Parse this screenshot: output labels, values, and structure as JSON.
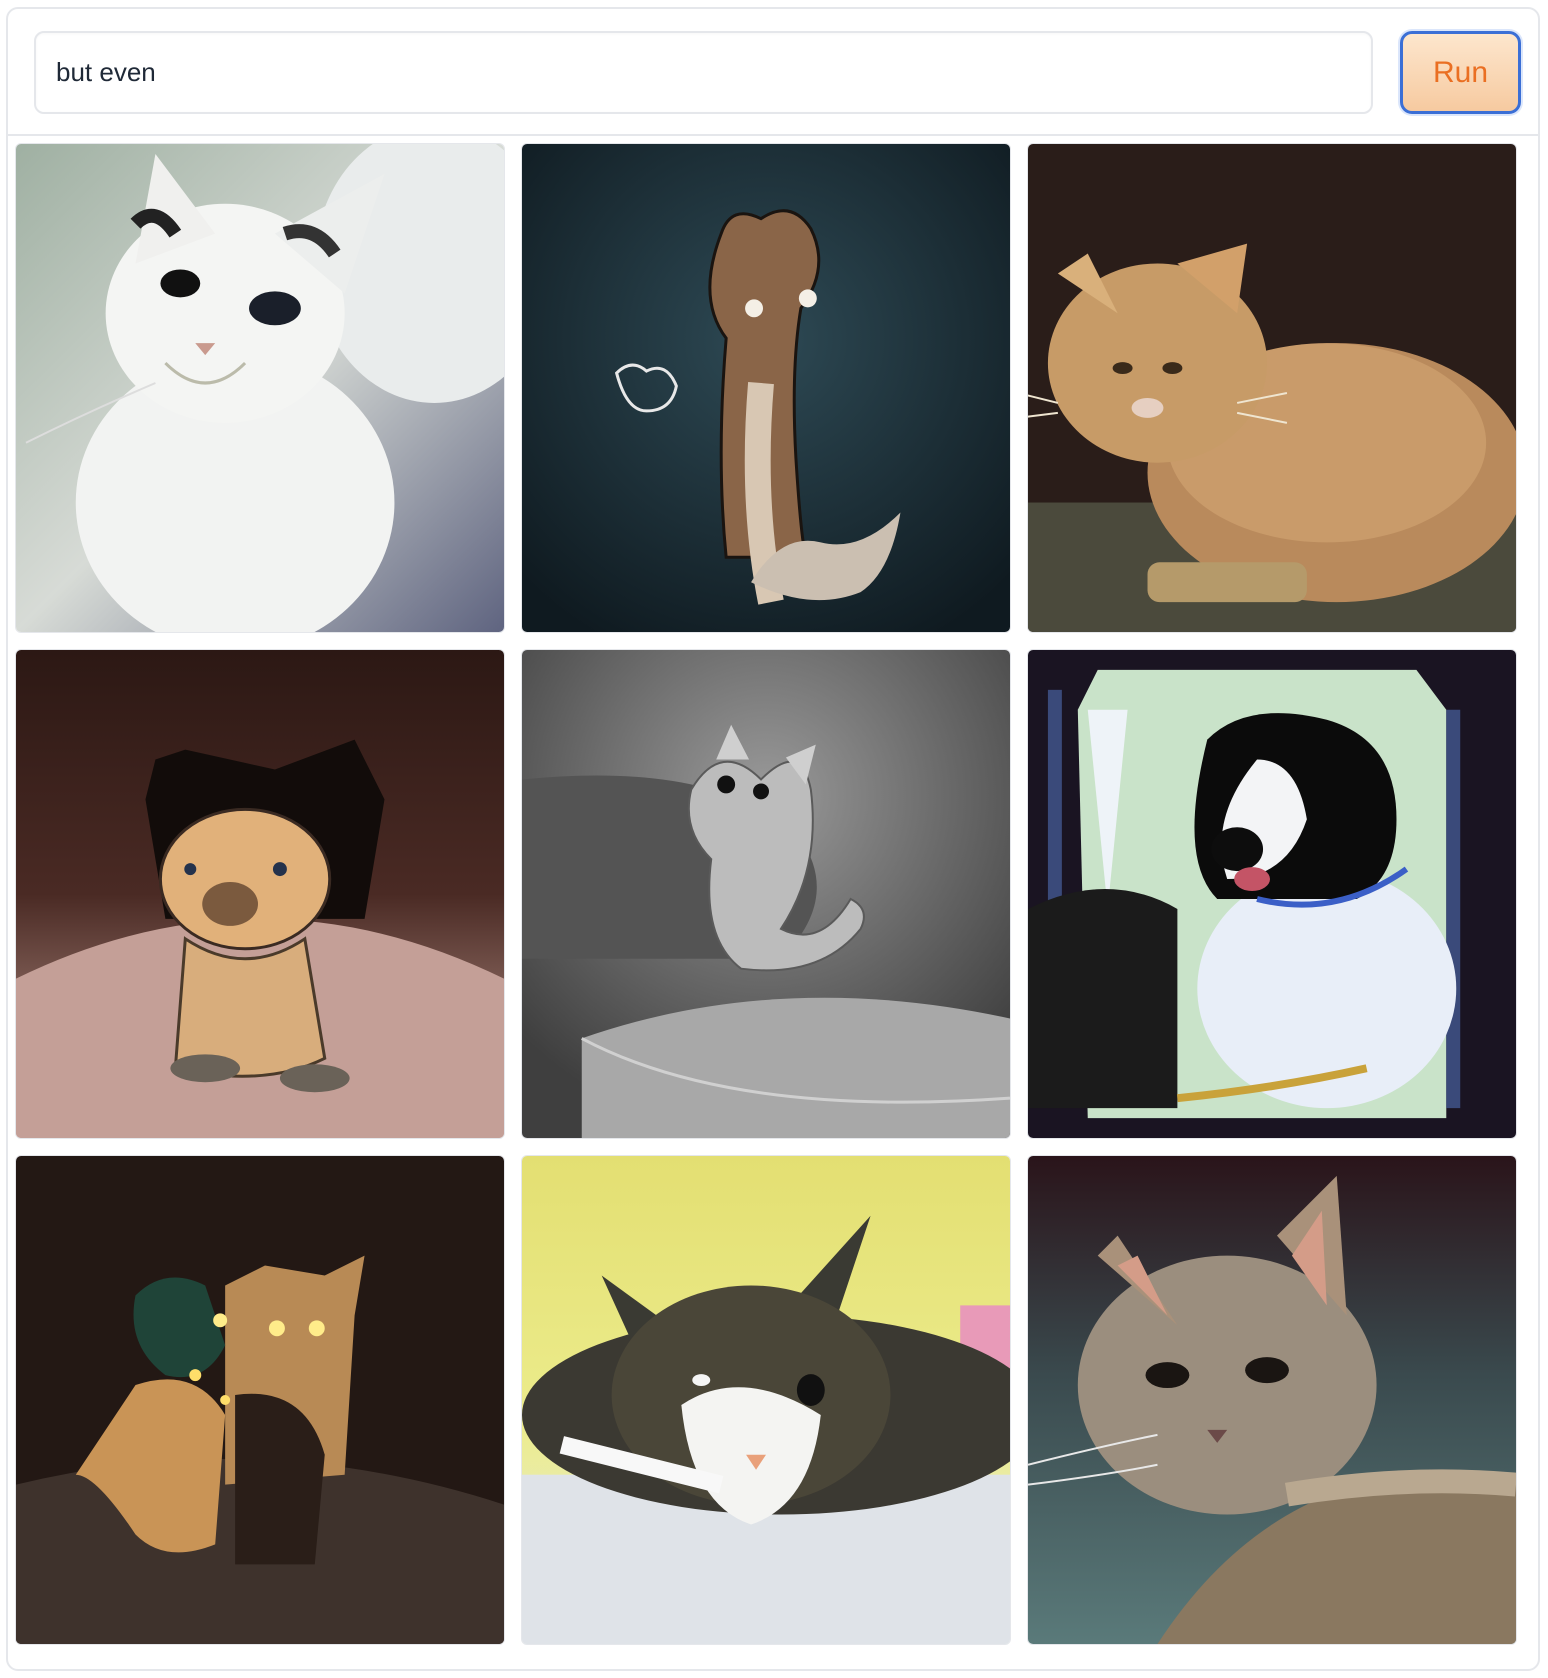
{
  "prompt": {
    "value": "but even"
  },
  "run_button": {
    "label": "Run"
  },
  "gallery": {
    "images": [
      {
        "subject": "white-cat-illustration"
      },
      {
        "subject": "brown-weasel-drawing"
      },
      {
        "subject": "orange-tabby-cat-photo"
      },
      {
        "subject": "cartoon-kitten-figurine"
      },
      {
        "subject": "gray-cat-on-blanket"
      },
      {
        "subject": "black-white-dog-cartoon"
      },
      {
        "subject": "glowing-eyed-creatures"
      },
      {
        "subject": "tuxedo-cat-lying-down"
      },
      {
        "subject": "gray-kitten-on-carpet"
      }
    ]
  },
  "colors": {
    "accent_text": "#ea6f22",
    "button_border": "#3b6fd6",
    "border": "#e5e7eb"
  }
}
